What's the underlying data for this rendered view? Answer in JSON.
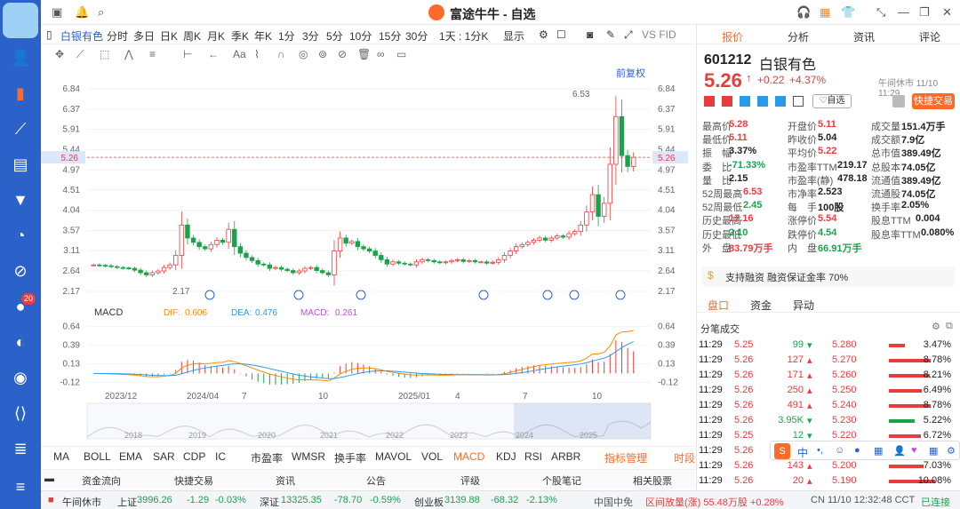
{
  "app": {
    "title": "富途牛牛 - 自选"
  },
  "nav": {
    "badge": "20"
  },
  "toolbar": {
    "stock_name": "白银有色",
    "periods": [
      "分时",
      "多日",
      "日K",
      "周K",
      "月K",
      "季K",
      "年K",
      "1分",
      "3分",
      "5分",
      "10分",
      "15分",
      "30分"
    ],
    "selected_period": "周K",
    "interval": "1天 : 1分K",
    "display": "显示",
    "vs_label": "VS FID"
  },
  "chart": {
    "adjust_label": "前复权",
    "price_axis": [
      "6.84",
      "6.37",
      "5.91",
      "5.44",
      "5.26",
      "4.97",
      "4.51",
      "4.04",
      "3.57",
      "3.11",
      "2.64",
      "2.17"
    ],
    "current_price_tag": "5.26",
    "high_label": "6.53",
    "low_label": "2.17",
    "x_labels": [
      "2023/12",
      "2024/04",
      "7",
      "10",
      "2025/01",
      "4",
      "7",
      "10"
    ],
    "macd_title": "MACD",
    "dif_label": "DIF:",
    "dif_value": "0.606",
    "dea_label": "DEA:",
    "dea_value": "0.476",
    "macd_label": "MACD:",
    "macd_value": "0.261",
    "macd_axis": [
      "0.64",
      "0.39",
      "0.13",
      "-0.12"
    ],
    "overview_years": [
      "2018",
      "2019",
      "2020",
      "2021",
      "2022",
      "2023",
      "2024",
      "2025"
    ]
  },
  "chart_data": {
    "type": "candlestick",
    "title": "601212 白银有色",
    "ylim": [
      2.17,
      6.84
    ],
    "closes": [
      2.78,
      2.77,
      2.76,
      2.74,
      2.72,
      2.71,
      2.7,
      2.66,
      2.6,
      2.55,
      2.6,
      2.64,
      2.72,
      2.78,
      3.0,
      3.7,
      3.4,
      3.3,
      3.2,
      3.15,
      3.25,
      3.35,
      3.3,
      3.6,
      3.2,
      3.05,
      2.95,
      2.88,
      2.8,
      2.78,
      2.7,
      2.72,
      2.68,
      2.65,
      2.6,
      2.64,
      2.7,
      2.72,
      2.65,
      2.6,
      2.55,
      3.1,
      3.4,
      3.28,
      3.32,
      3.2,
      3.15,
      3.1,
      3.0,
      2.9,
      2.8,
      2.85,
      2.82,
      2.8,
      2.78,
      2.85,
      2.9,
      2.88,
      2.85,
      2.83,
      2.85,
      2.88,
      2.9,
      2.86,
      2.88,
      2.85,
      2.85,
      2.82,
      2.84,
      2.9,
      3.0,
      3.1,
      3.2,
      3.25,
      3.3,
      3.35,
      3.4,
      3.35,
      3.4,
      3.45,
      3.42,
      3.5,
      3.55,
      3.7,
      4.0,
      4.4,
      3.9,
      4.2,
      5.1,
      6.2,
      5.3,
      5.05,
      5.26
    ],
    "macd": {
      "dif": 0.606,
      "dea": 0.476,
      "macd": 0.261
    },
    "last_price": 5.26,
    "period_high": 6.53,
    "period_low": 2.17
  },
  "quote": {
    "tabs": [
      "报价",
      "分析",
      "资讯",
      "评论"
    ],
    "code": "601212",
    "name": "白银有色",
    "price": "5.26",
    "change": "+0.22",
    "pct": "+4.37%",
    "status": "午间休市 11/10 11:29",
    "watch_label": "自选",
    "fast_trade": "快捷交易",
    "fields": [
      [
        "最高价",
        "5.28",
        "up"
      ],
      [
        "开盘价",
        "5.11",
        "up"
      ],
      [
        "成交量",
        "151.4万手",
        "blk"
      ],
      [
        "最低价",
        "5.11",
        "up"
      ],
      [
        "昨收价",
        "5.04",
        "blk"
      ],
      [
        "成交额",
        "7.9亿",
        "blk"
      ],
      [
        "振　幅",
        "3.37%",
        "blk"
      ],
      [
        "平均价",
        "5.22",
        "up"
      ],
      [
        "总市值",
        "389.49亿",
        "blk"
      ],
      [
        "委　比",
        "-71.33%",
        "down"
      ],
      [
        "市盈率TTM",
        "219.17",
        "blk"
      ],
      [
        "总股本",
        "74.05亿",
        "blk"
      ],
      [
        "量　比",
        "2.15",
        "blk"
      ],
      [
        "市盈率(静)",
        "478.18",
        "blk"
      ],
      [
        "流通值",
        "389.49亿",
        "blk"
      ],
      [
        "52周最高",
        "6.53",
        "up"
      ],
      [
        "市净率",
        "2.523",
        "blk"
      ],
      [
        "流通股",
        "74.05亿",
        "blk"
      ],
      [
        "52周最低",
        "2.45",
        "down"
      ],
      [
        "每　手",
        "100股",
        "blk"
      ],
      [
        "换手率",
        "2.05%",
        "blk"
      ],
      [
        "历史最高",
        "17.16",
        "up"
      ],
      [
        "涨停价",
        "5.54",
        "up"
      ],
      [
        "股息TTM",
        "0.004",
        "blk"
      ],
      [
        "历史最低",
        "2.10",
        "down"
      ],
      [
        "跌停价",
        "4.54",
        "down"
      ],
      [
        "股息率TTM",
        "0.080%",
        "blk"
      ],
      [
        "外　盘",
        "83.79万手",
        "up"
      ],
      [
        "内　盘",
        "66.91万手",
        "down"
      ],
      [
        "",
        ""
      ]
    ],
    "margin_text": "支持融资 融资保证金率 70%",
    "subtabs": [
      "盘口",
      "资金",
      "异动"
    ],
    "ticks_title": "分笔成交",
    "ticks": [
      [
        "11:29",
        "5.25",
        "99",
        "down"
      ],
      [
        "11:29",
        "5.26",
        "127",
        "up"
      ],
      [
        "11:29",
        "5.26",
        "171",
        "up"
      ],
      [
        "11:29",
        "5.26",
        "250",
        "up"
      ],
      [
        "11:29",
        "5.26",
        "491",
        "up"
      ],
      [
        "11:29",
        "5.26",
        "3.95K",
        "down"
      ],
      [
        "11:29",
        "5.25",
        "12",
        "down"
      ],
      [
        "11:29",
        "5.26",
        "",
        ""
      ],
      [
        "11:29",
        "5.26",
        "143",
        "up"
      ],
      [
        "11:29",
        "5.26",
        "20",
        "up"
      ]
    ],
    "book": [
      [
        "5.280",
        "3.47%"
      ],
      [
        "5.270",
        "8.78%"
      ],
      [
        "5.260",
        "8.21%"
      ],
      [
        "5.250",
        "6.49%"
      ],
      [
        "5.240",
        "8.78%"
      ],
      [
        "5.230",
        "5.22%"
      ],
      [
        "5.220",
        "6.72%"
      ],
      [
        "",
        ""
      ],
      [
        "5.200",
        "7.03%"
      ],
      [
        "5.190",
        "10.08%"
      ]
    ]
  },
  "indicators": [
    "MA",
    "BOLL",
    "EMA",
    "SAR",
    "CDP",
    "IC",
    "市盈率",
    "WMSR",
    "换手率",
    "MAVOL",
    "VOL",
    "MACD",
    "KDJ",
    "RSI",
    "ARBR",
    "指标管理",
    "时段"
  ],
  "selected_indicator": "MACD",
  "links": [
    "资金流向",
    "快捷交易",
    "资讯",
    "公告",
    "评级",
    "个股笔记",
    "相关股票"
  ],
  "status": {
    "market": "午间休市",
    "sh_label": "上证",
    "sh_val": "3996.26",
    "sh_chg": "-1.29",
    "sh_pct": "-0.03%",
    "sz_label": "深证",
    "sz_val": "13325.35",
    "sz_chg": "-78.70",
    "sz_pct": "-0.59%",
    "cy_label": "创业板",
    "cy_val": "3139.88",
    "cy_chg": "-68.32",
    "cy_pct": "-2.13%",
    "fund": "中国中免",
    "fund_text": "区间放量(涨) 55.48万股 +0.28%",
    "clock": "CN 11/10 12:32:48 CCT",
    "login": "已连接"
  }
}
